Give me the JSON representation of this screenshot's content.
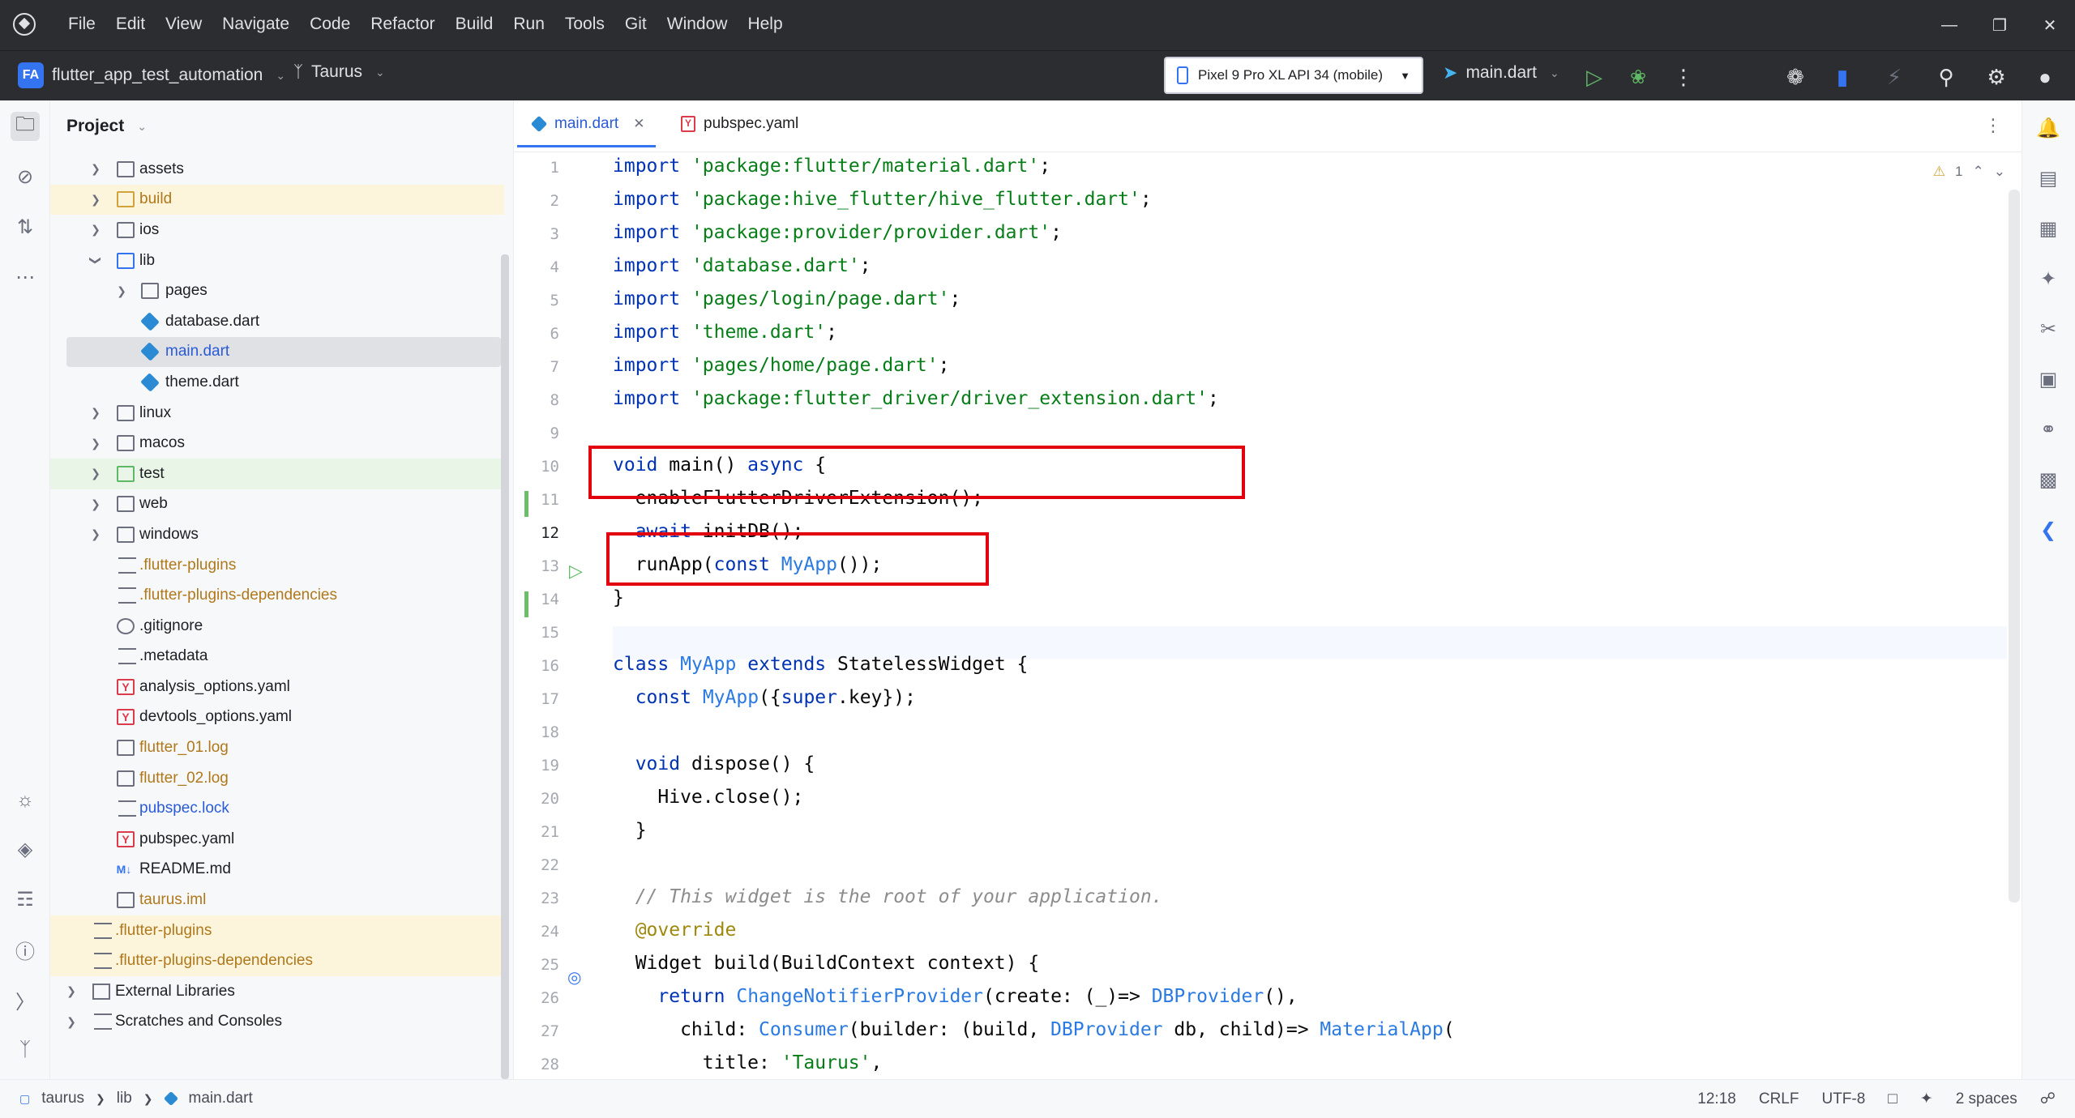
{
  "menu": [
    "File",
    "Edit",
    "View",
    "Navigate",
    "Code",
    "Refactor",
    "Build",
    "Run",
    "Tools",
    "Git",
    "Window",
    "Help"
  ],
  "toolbar": {
    "project_badge": "FA",
    "project_name": "flutter_app_test_automation",
    "branch": "Taurus",
    "device": "Pixel 9 Pro XL API 34 (mobile)",
    "run_config": "main.dart"
  },
  "project_panel": {
    "title": "Project",
    "items": [
      {
        "label": "assets",
        "type": "folder"
      },
      {
        "label": "build",
        "type": "folder-orange"
      },
      {
        "label": "ios",
        "type": "folder"
      },
      {
        "label": "lib",
        "type": "folder"
      },
      {
        "label": "pages",
        "type": "folder"
      },
      {
        "label": "database.dart",
        "type": "dart"
      },
      {
        "label": "main.dart",
        "type": "dart"
      },
      {
        "label": "theme.dart",
        "type": "dart"
      },
      {
        "label": "linux",
        "type": "folder"
      },
      {
        "label": "macos",
        "type": "folder"
      },
      {
        "label": "test",
        "type": "folder"
      },
      {
        "label": "web",
        "type": "folder"
      },
      {
        "label": "windows",
        "type": "folder"
      },
      {
        "label": ".flutter-plugins",
        "type": "text"
      },
      {
        "label": ".flutter-plugins-dependencies",
        "type": "text"
      },
      {
        "label": ".gitignore",
        "type": "ignore"
      },
      {
        "label": ".metadata",
        "type": "text"
      },
      {
        "label": "analysis_options.yaml",
        "type": "yaml"
      },
      {
        "label": "devtools_options.yaml",
        "type": "yaml"
      },
      {
        "label": "flutter_01.log",
        "type": "log"
      },
      {
        "label": "flutter_02.log",
        "type": "log"
      },
      {
        "label": "pubspec.lock",
        "type": "text"
      },
      {
        "label": "pubspec.yaml",
        "type": "yaml"
      },
      {
        "label": "README.md",
        "type": "md"
      },
      {
        "label": "taurus.iml",
        "type": "log"
      },
      {
        "label": ".flutter-plugins",
        "type": "text"
      },
      {
        "label": ".flutter-plugins-dependencies",
        "type": "text"
      },
      {
        "label": "External Libraries",
        "type": "lib"
      },
      {
        "label": "Scratches and Consoles",
        "type": "lib"
      }
    ]
  },
  "editor": {
    "tabs": [
      {
        "label": "main.dart",
        "active": true
      },
      {
        "label": "pubspec.yaml",
        "active": false
      }
    ],
    "inspection_count": "1",
    "line_numbers": [
      "1",
      "2",
      "3",
      "4",
      "5",
      "6",
      "7",
      "8",
      "9",
      "10",
      "11",
      "12",
      "13",
      "14",
      "15",
      "16",
      "17",
      "18",
      "19",
      "20",
      "21",
      "22",
      "23",
      "24",
      "25",
      "26",
      "27",
      "28"
    ],
    "current_line": "12",
    "code": [
      "import 'package:flutter/material.dart';",
      "import 'package:hive_flutter/hive_flutter.dart';",
      "import 'package:provider/provider.dart';",
      "import 'database.dart';",
      "import 'pages/login/page.dart';",
      "import 'theme.dart';",
      "import 'pages/home/page.dart';",
      "import 'package:flutter_driver/driver_extension.dart';",
      "",
      "void main() async {",
      "  enableFlutterDriverExtension();",
      "  await initDB();",
      "  runApp(const MyApp());",
      "}",
      "",
      "class MyApp extends StatelessWidget {",
      "  const MyApp({super.key});",
      "",
      "  void dispose() {",
      "    Hive.close();",
      "  }",
      "",
      "  // This widget is the root of your application.",
      "  @override",
      "  Widget build(BuildContext context) {",
      "    return ChangeNotifierProvider(create: (_)=> DBProvider(),",
      "      child: Consumer(builder: (build, DBProvider db, child)=> MaterialApp(",
      "        title: 'Taurus',"
    ]
  },
  "statusbar": {
    "breadcrumbs": [
      "taurus",
      "lib",
      "main.dart"
    ],
    "position": "12:18",
    "line_ending": "CRLF",
    "encoding": "UTF-8",
    "indent": "2 spaces"
  },
  "colors": {
    "accent": "#3574f0",
    "keyword": "#0033b3",
    "string": "#067d17",
    "highlight_box": "#e2000f",
    "change_marker": "#6bbf6b"
  }
}
